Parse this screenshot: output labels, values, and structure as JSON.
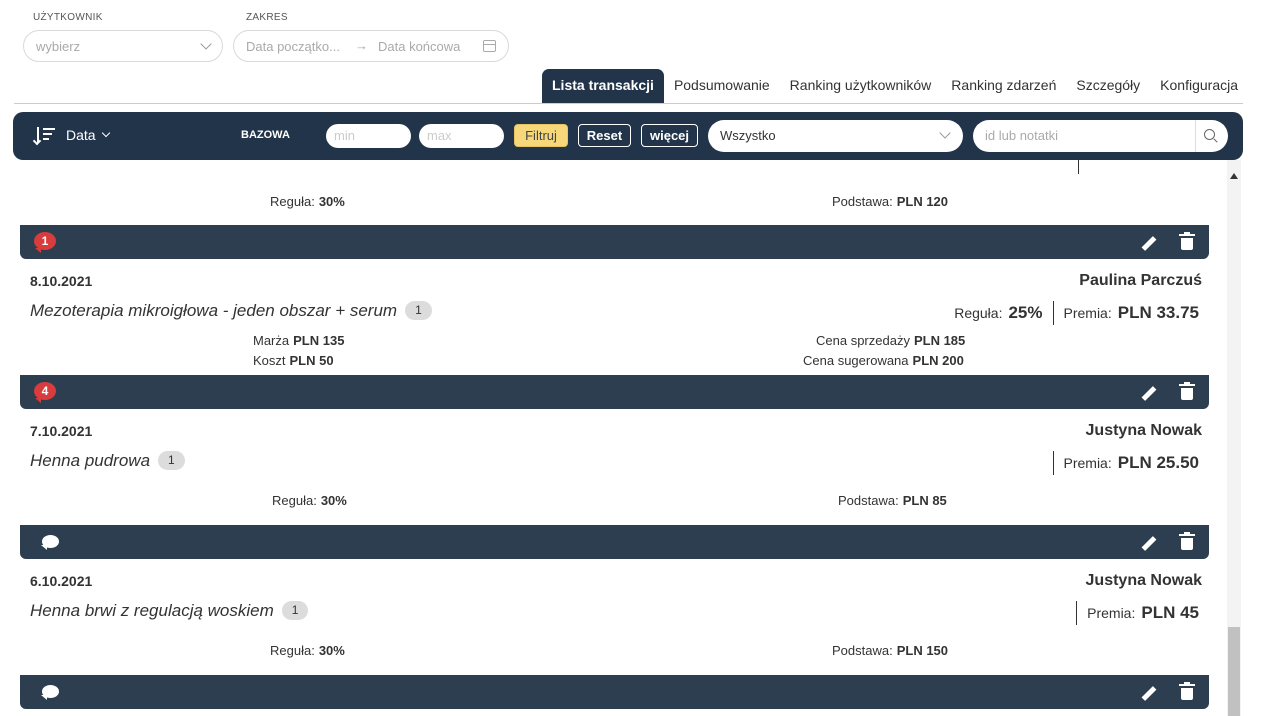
{
  "filters": {
    "user_label": "UŻYTKOWNIK",
    "user_placeholder": "wybierz",
    "range_label": "ZAKRES",
    "date_from_placeholder": "Data początko...",
    "arrow": "→",
    "date_to_placeholder": "Data końcowa"
  },
  "tabs": [
    {
      "label": "Lista transakcji",
      "active": true
    },
    {
      "label": "Podsumowanie",
      "active": false
    },
    {
      "label": "Ranking użytkowników",
      "active": false
    },
    {
      "label": "Ranking zdarzeń",
      "active": false
    },
    {
      "label": "Szczegóły",
      "active": false
    },
    {
      "label": "Konfiguracja",
      "active": false
    }
  ],
  "toolbar": {
    "sort_label": "Data",
    "base_label": "BAZOWA",
    "min_placeholder": "min",
    "max_placeholder": "max",
    "filter_button": "Filtruj",
    "reset_button": "Reset",
    "more_button": "więcej",
    "type_select_value": "Wszystko",
    "search_placeholder": "id lub notatki"
  },
  "cards": [
    {
      "partial": true,
      "rule_label": "Reguła:",
      "rule_value": "30%",
      "base_label": "Podstawa:",
      "base_value": "PLN 120",
      "comments": "1"
    },
    {
      "date": "8.10.2021",
      "user": "Paulina Parczuś",
      "service": "Mezoterapia mikroigłowa - jeden obszar + serum",
      "count": "1",
      "rule_label": "Reguła:",
      "rule_value": "25%",
      "bonus_label": "Premia:",
      "bonus_value": "PLN 33.75",
      "margin_label": "Marża",
      "margin_value": "PLN 135",
      "cost_label": "Koszt",
      "cost_value": "PLN 50",
      "sale_label": "Cena sprzedaży",
      "sale_value": "PLN 185",
      "suggested_label": "Cena sugerowana",
      "suggested_value": "PLN 200",
      "comments": "4"
    },
    {
      "date": "7.10.2021",
      "user": "Justyna Nowak",
      "service": "Henna pudrowa",
      "count": "1",
      "bonus_label": "Premia:",
      "bonus_value": "PLN 25.50",
      "rule_label": "Reguła:",
      "rule_value": "30%",
      "base_label": "Podstawa:",
      "base_value": "PLN 85"
    },
    {
      "date": "6.10.2021",
      "user": "Justyna Nowak",
      "service": "Henna brwi z regulacją woskiem",
      "count": "1",
      "bonus_label": "Premia:",
      "bonus_value": "PLN 45",
      "rule_label": "Reguła:",
      "rule_value": "30%",
      "base_label": "Podstawa:",
      "base_value": "PLN 150"
    }
  ],
  "colors": {
    "navy": "#22344a",
    "card_footer": "#2d3e50",
    "filter_yellow": "#f6d87a",
    "comment_red": "#d93c3c"
  },
  "icons": [
    "chevron-down-icon",
    "calendar-icon",
    "sort-icon",
    "search-icon",
    "comment-icon",
    "pencil-icon",
    "trash-icon"
  ]
}
